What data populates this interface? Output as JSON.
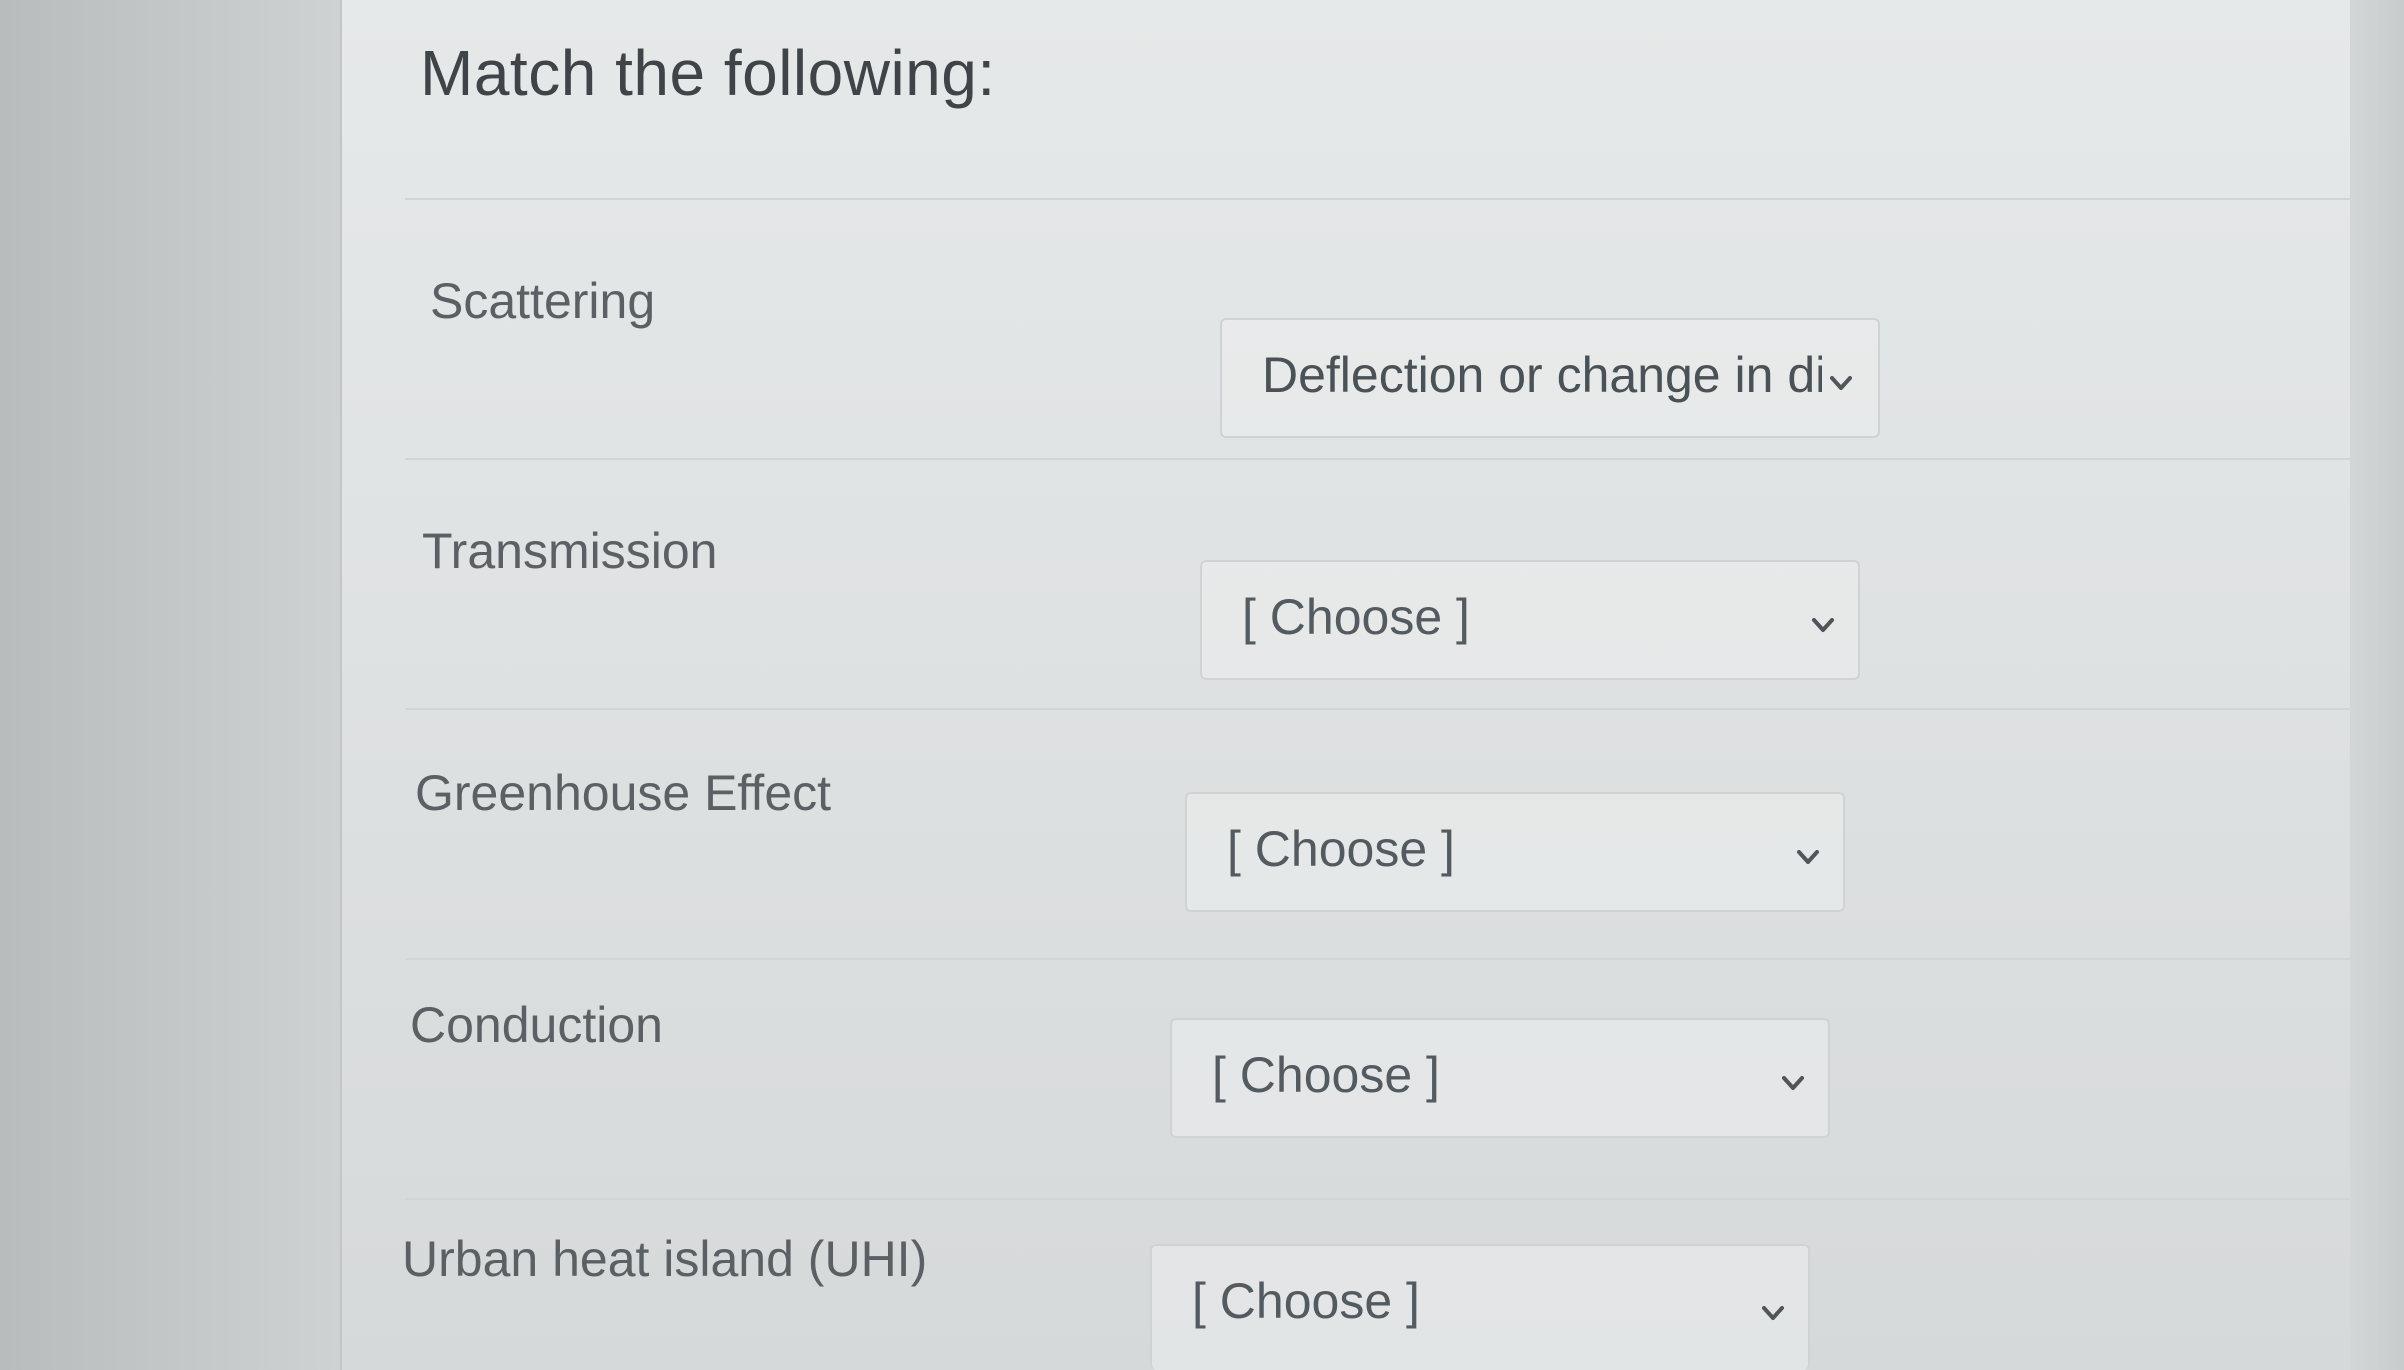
{
  "question": {
    "title": "Match the following:"
  },
  "items": [
    {
      "term": "Scattering",
      "selected": "Deflection or change in di"
    },
    {
      "term": "Transmission",
      "selected": "[ Choose ]"
    },
    {
      "term": "Greenhouse Effect",
      "selected": "[ Choose ]"
    },
    {
      "term": "Conduction",
      "selected": "[ Choose ]"
    },
    {
      "term": "Urban heat island (UHI)",
      "selected": "[ Choose ]"
    }
  ],
  "icons": {
    "dropdown": "chevron-down-icon"
  },
  "colors": {
    "text": "#5a6064",
    "title": "#3e4447",
    "border": "#cfd3d4",
    "chevron": "#4f565b"
  }
}
